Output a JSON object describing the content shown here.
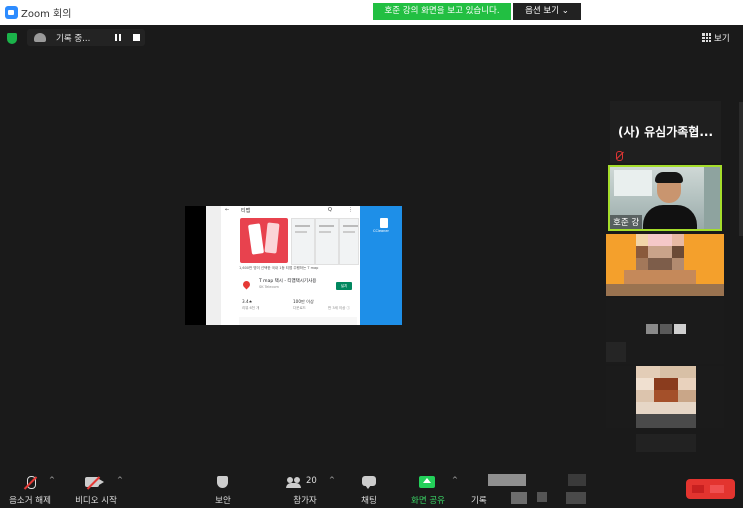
{
  "window": {
    "title": "Zoom 회의"
  },
  "share_banner": {
    "text": "호준 강의 화면을 보고 있습니다.",
    "view_options": "옵션 보기 ⌄"
  },
  "topbar": {
    "recording_label": "기록 중...",
    "view_label": "보기"
  },
  "shared_screen": {
    "store_title": "티맵",
    "store_search": "Q",
    "store_more": "⋮",
    "back_arrow": "←",
    "tagline": "1,600만 명이 선택한 국내 1등 티맵 주행하는 T map",
    "app_name": "T map 택시 - 티맵택시기사용",
    "app_developer": "SK Telecom",
    "install_label": "설치",
    "stats": [
      {
        "value": "3.4★",
        "label": "리뷰 6천 개"
      },
      {
        "value": "100만 이상",
        "label": "다운로드"
      },
      {
        "value": "",
        "label": "만 3세 이상 ⓘ"
      }
    ],
    "desktop_icon_label": "CCleaner"
  },
  "participants": {
    "name_tile": "(사) 유심가족협...",
    "video_tile_name": "호준 강"
  },
  "toolbar": {
    "unmute": "음소거 해제",
    "start_video": "비디오 시작",
    "security": "보안",
    "participants": "참가자",
    "participants_count": "20",
    "chat": "채팅",
    "share_screen": "화면 공유",
    "record": "기록",
    "caret": "^"
  },
  "colors": {
    "share_green": "#22bf42",
    "active_speaker_border": "#a5dd2b",
    "end_red": "#e3342f",
    "background": "#1a1a1a"
  }
}
